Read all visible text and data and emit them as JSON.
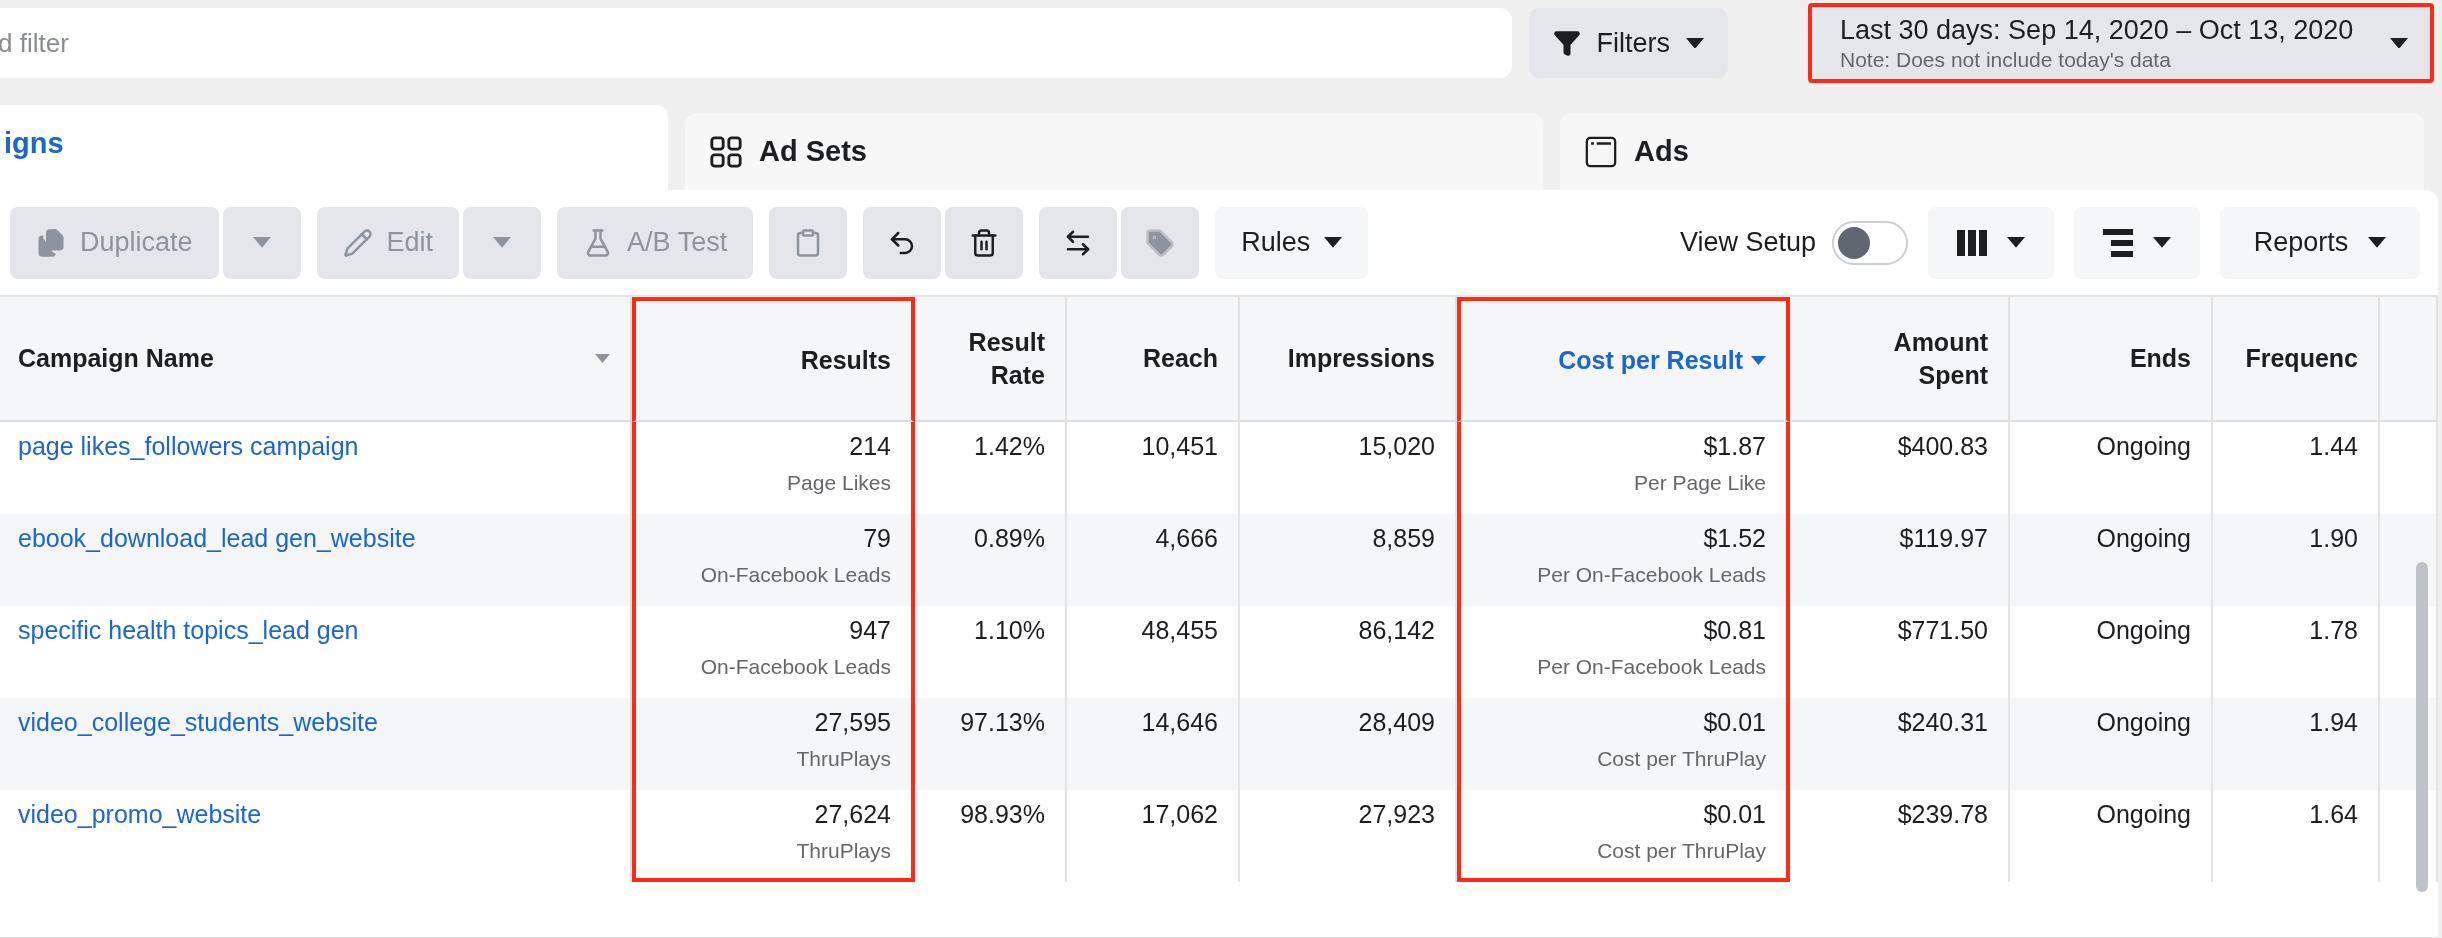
{
  "search": {
    "placeholder": "d filter"
  },
  "filters_button": {
    "label": "Filters"
  },
  "date_range": {
    "label": "Last 30 days: Sep 14, 2020 – Oct 13, 2020",
    "note": "Note: Does not include today's data",
    "highlighted": true
  },
  "tabs": [
    {
      "label": "igns",
      "selected": true,
      "kind": "campaigns"
    },
    {
      "label": "Ad Sets",
      "selected": false,
      "kind": "adsets"
    },
    {
      "label": "Ads",
      "selected": false,
      "kind": "ads"
    }
  ],
  "toolbar": [
    {
      "kind": "duplicate",
      "label": "Duplicate",
      "disabled": true
    },
    {
      "kind": "caret",
      "disabled": true
    },
    {
      "kind": "edit",
      "label": "Edit",
      "disabled": true
    },
    {
      "kind": "caret",
      "disabled": true
    },
    {
      "kind": "abtest",
      "label": "A/B Test",
      "disabled": true
    },
    {
      "kind": "clipboard",
      "disabled": true
    },
    {
      "kind": "undo",
      "disabled": false
    },
    {
      "kind": "trash",
      "disabled": false
    },
    {
      "kind": "swap",
      "disabled": false
    },
    {
      "kind": "tag",
      "disabled": true
    },
    {
      "kind": "rules",
      "label": "Rules",
      "disabled": false
    }
  ],
  "view_setup": {
    "label": "View Setup",
    "on": false
  },
  "right_buttons": [
    {
      "kind": "columns"
    },
    {
      "kind": "breakdown"
    },
    {
      "kind": "reports",
      "label": "Reports"
    }
  ],
  "table": {
    "columns": [
      {
        "label": "Campaign Name",
        "kind": "name",
        "caret": true,
        "sorted": false,
        "highlighted": false
      },
      {
        "label": "Results",
        "kind": "metric",
        "caret": false,
        "sorted": false,
        "highlighted": true
      },
      {
        "label": "Result Rate",
        "kind": "metric",
        "caret": false,
        "sorted": false,
        "highlighted": false
      },
      {
        "label": "Reach",
        "kind": "metric",
        "caret": false,
        "sorted": false,
        "highlighted": false
      },
      {
        "label": "Impressions",
        "kind": "metric",
        "caret": false,
        "sorted": false,
        "highlighted": false
      },
      {
        "label": "Cost per Result",
        "kind": "metric",
        "caret": true,
        "sorted": true,
        "highlighted": true
      },
      {
        "label": "Amount Spent",
        "kind": "metric",
        "caret": false,
        "sorted": false,
        "highlighted": false
      },
      {
        "label": "Ends",
        "kind": "metric",
        "caret": false,
        "sorted": false,
        "highlighted": false
      },
      {
        "label": "Frequenc",
        "kind": "metric",
        "caret": false,
        "sorted": false,
        "highlighted": false
      }
    ],
    "rows": [
      {
        "cells": [
          {
            "text": "page likes_followers campaign"
          },
          {
            "text": "214",
            "sub": "Page Likes"
          },
          {
            "text": "1.42%"
          },
          {
            "text": "10,451"
          },
          {
            "text": "15,020"
          },
          {
            "text": "$1.87",
            "sub": "Per Page Like"
          },
          {
            "text": "$400.83"
          },
          {
            "text": "Ongoing"
          },
          {
            "text": "1.44"
          }
        ]
      },
      {
        "cells": [
          {
            "text": "ebook_download_lead gen_website"
          },
          {
            "text": "79",
            "sub": "On-Facebook Leads"
          },
          {
            "text": "0.89%"
          },
          {
            "text": "4,666"
          },
          {
            "text": "8,859"
          },
          {
            "text": "$1.52",
            "sub": "Per On-Facebook Leads"
          },
          {
            "text": "$119.97"
          },
          {
            "text": "Ongoing"
          },
          {
            "text": "1.90"
          }
        ]
      },
      {
        "cells": [
          {
            "text": "specific health topics_lead gen"
          },
          {
            "text": "947",
            "sub": "On-Facebook Leads"
          },
          {
            "text": "1.10%"
          },
          {
            "text": "48,455"
          },
          {
            "text": "86,142"
          },
          {
            "text": "$0.81",
            "sub": "Per On-Facebook Leads"
          },
          {
            "text": "$771.50"
          },
          {
            "text": "Ongoing"
          },
          {
            "text": "1.78"
          }
        ]
      },
      {
        "cells": [
          {
            "text": "video_college_students_website"
          },
          {
            "text": "27,595",
            "sub": "ThruPlays"
          },
          {
            "text": "97.13%"
          },
          {
            "text": "14,646"
          },
          {
            "text": "28,409"
          },
          {
            "text": "$0.01",
            "sub": "Cost per ThruPlay"
          },
          {
            "text": "$240.31"
          },
          {
            "text": "Ongoing"
          },
          {
            "text": "1.94"
          }
        ]
      },
      {
        "cells": [
          {
            "text": "video_promo_website"
          },
          {
            "text": "27,624",
            "sub": "ThruPlays"
          },
          {
            "text": "98.93%"
          },
          {
            "text": "17,062"
          },
          {
            "text": "27,923"
          },
          {
            "text": "$0.01",
            "sub": "Cost per ThruPlay"
          },
          {
            "text": "$239.78"
          },
          {
            "text": "Ongoing"
          },
          {
            "text": "1.64"
          }
        ]
      }
    ]
  }
}
